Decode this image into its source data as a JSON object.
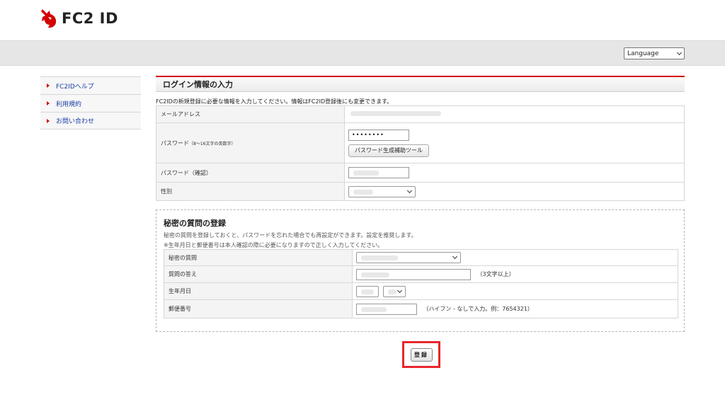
{
  "brand": {
    "logo_text": "FC2 ID",
    "accent": "#d40000"
  },
  "language": {
    "selected": "Language"
  },
  "sidebar": {
    "items": [
      {
        "label": "FC2IDヘルプ"
      },
      {
        "label": "利用規約"
      },
      {
        "label": "お問い合わせ"
      }
    ]
  },
  "login": {
    "title": "ログイン情報の入力",
    "intro": "FC2IDの新規登録に必要な情報を入力してください。情報はFC2ID登録後にも変更できます。",
    "email_label": "メールアドレス",
    "password_label": "パスワード",
    "password_note": "（8〜16文字の英数字）",
    "password_value": "••••••••",
    "password_tool_button": "パスワード生成補助ツール",
    "password_confirm_label": "パスワード（確認）",
    "gender_label": "性別"
  },
  "secret": {
    "title": "秘密の質問の登録",
    "desc1": "秘密の質問を登録しておくと、パスワードを忘れた場合でも再設定ができます。設定を推奨します。",
    "desc2": "※生年月日と郵便番号は本人確認の際に必要になりますので正しく入力してください。",
    "question_label": "秘密の質問",
    "answer_label": "質問の答え",
    "answer_hint": "（3文字以上）",
    "birthday_label": "生年月日",
    "postal_label": "郵便番号",
    "postal_hint": "（ハイフン - なしで入力。例：7654321）"
  },
  "submit": {
    "label": "登録",
    "highlight_color": "#e8262c"
  }
}
